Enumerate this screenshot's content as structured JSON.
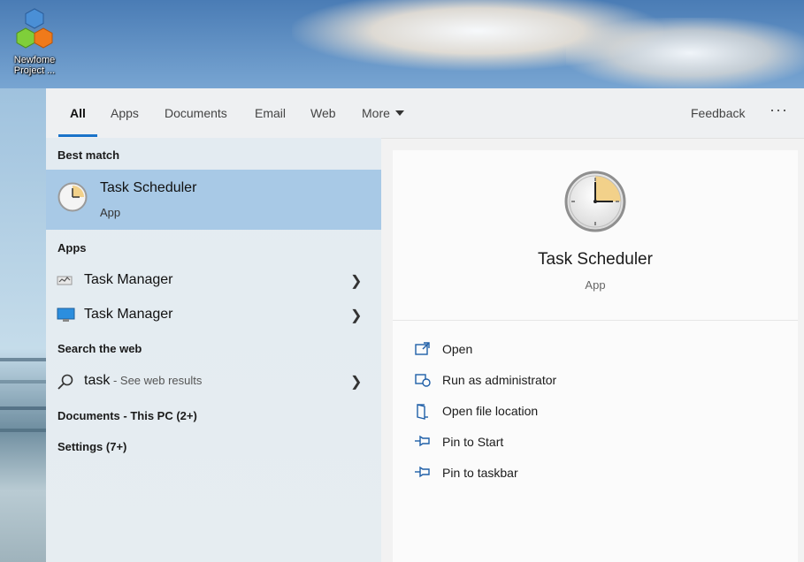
{
  "desktop": {
    "icon_label_line1": "Newfome",
    "icon_label_line2": "Project ..."
  },
  "tabs": [
    {
      "label": "All",
      "active": true
    },
    {
      "label": "Apps"
    },
    {
      "label": "Documents"
    },
    {
      "label": "Email"
    },
    {
      "label": "Web"
    },
    {
      "label": "More"
    }
  ],
  "header": {
    "feedback_label": "Feedback",
    "more_options": "···"
  },
  "results": {
    "best_match_heading": "Best match",
    "best_match": {
      "title": "Task Scheduler",
      "subtitle": "App",
      "icon": "clock-icon"
    },
    "apps_heading": "Apps",
    "apps": [
      {
        "label": "Task Manager",
        "icon": "task-manager-icon"
      },
      {
        "label": "Task Manager",
        "icon": "monitor-icon"
      }
    ],
    "web_heading": "Search the web",
    "web_query": "task",
    "web_suffix": " - See web results",
    "documents_heading": "Documents - This PC (2+)",
    "settings_heading": "Settings (7+)"
  },
  "detail": {
    "title": "Task Scheduler",
    "subtitle": "App",
    "actions": [
      {
        "label": "Open",
        "icon": "open-icon"
      },
      {
        "label": "Run as administrator",
        "icon": "shield-run-icon"
      },
      {
        "label": "Open file location",
        "icon": "folder-location-icon"
      },
      {
        "label": "Pin to Start",
        "icon": "pin-icon"
      },
      {
        "label": "Pin to taskbar",
        "icon": "pin-icon"
      }
    ]
  },
  "colors": {
    "accent": "#1a73c9",
    "selected_row": "#a8c9e6",
    "clock_fill": "#f2d18a"
  }
}
